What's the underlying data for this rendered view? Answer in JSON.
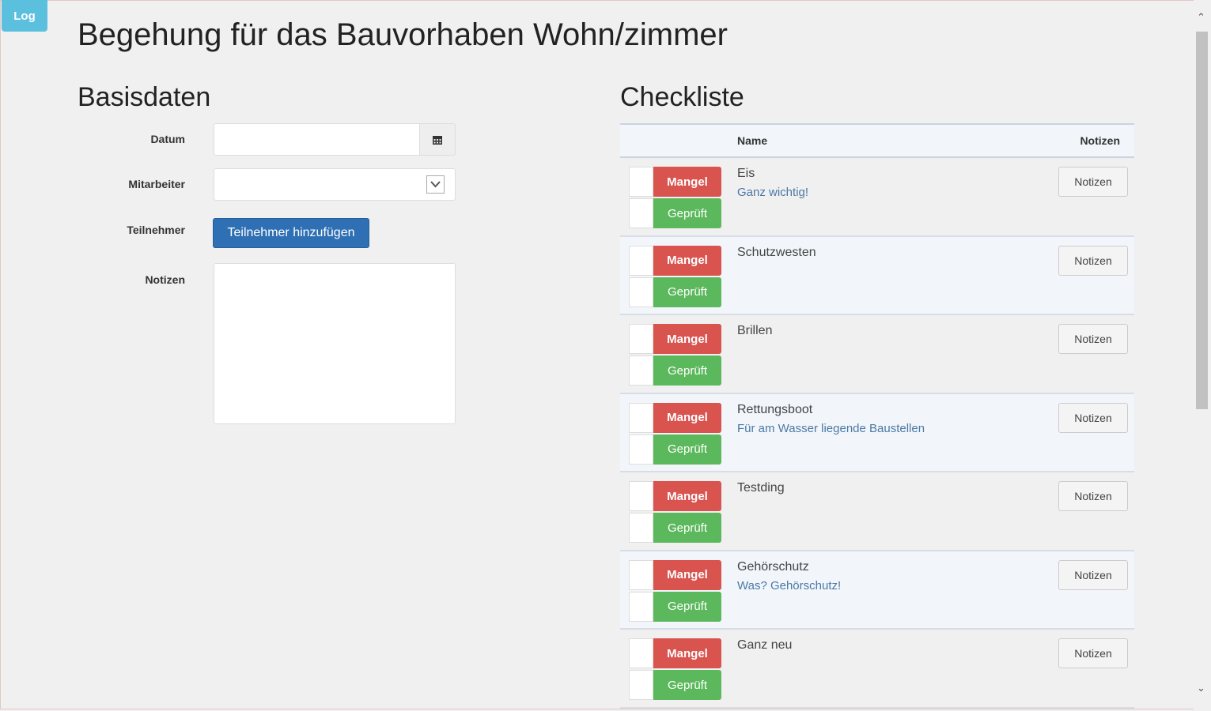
{
  "toolbar": {
    "log_label": "Log"
  },
  "page": {
    "title": "Begehung für das Bauvorhaben Wohn/zimmer"
  },
  "basisdaten": {
    "title": "Basisdaten",
    "datum_label": "Datum",
    "mitarbeiter_label": "Mitarbeiter",
    "teilnehmer_label": "Teilnehmer",
    "teilnehmer_button": "Teilnehmer hinzufügen",
    "notizen_label": "Notizen",
    "datum_value": "",
    "mitarbeiter_value": "",
    "notizen_value": ""
  },
  "checkliste": {
    "title": "Checkliste",
    "columns": {
      "name": "Name",
      "notizen": "Notizen"
    },
    "mangel_label": "Mangel",
    "geprueft_label": "Geprüft",
    "notes_button_label": "Notizen",
    "items": [
      {
        "name": "Eis",
        "description": "Ganz wichtig!"
      },
      {
        "name": "Schutzwesten",
        "description": ""
      },
      {
        "name": "Brillen",
        "description": ""
      },
      {
        "name": "Rettungsboot",
        "description": "Für am Wasser liegende Baustellen"
      },
      {
        "name": "Testding",
        "description": ""
      },
      {
        "name": "Gehörschutz",
        "description": "Was? Gehörschutz!"
      },
      {
        "name": "Ganz neu",
        "description": ""
      }
    ]
  },
  "icons": {
    "calendar": "calendar-icon",
    "dropdown": "chevron-down-icon",
    "scroll_up": "chevron-up-icon",
    "scroll_down": "chevron-down-icon"
  },
  "colors": {
    "mangel": "#d9534f",
    "geprueft": "#5cb85c",
    "primary": "#2f6fb4",
    "log": "#5bc0de"
  }
}
